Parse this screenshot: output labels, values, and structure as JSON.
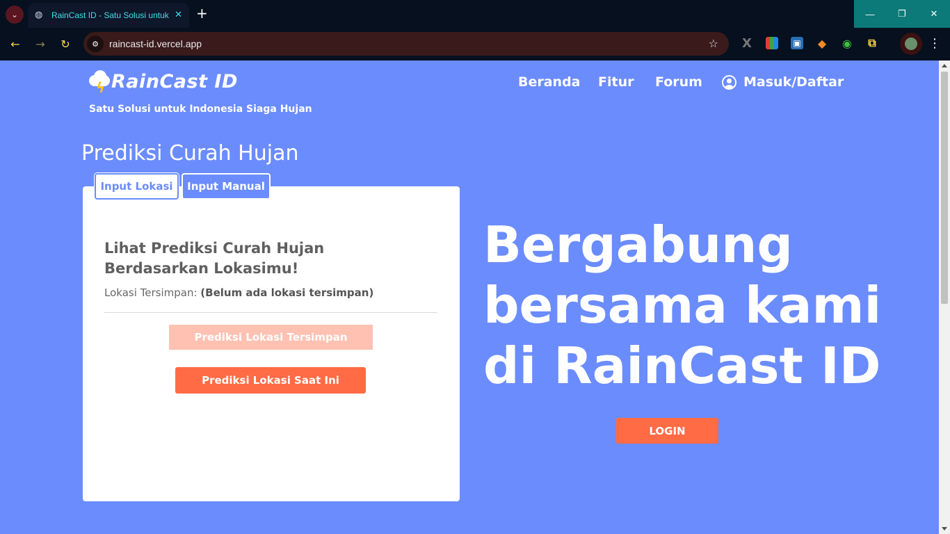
{
  "browser": {
    "tab_title": "RainCast ID - Satu Solusi untuk Indonesia Siaga Hujan",
    "url": "raincast-id.vercel.app",
    "win_minimize": "—",
    "win_restore": "❐",
    "win_close": "✕"
  },
  "header": {
    "brand": "RainCast ID",
    "tagline": "Satu Solusi untuk Indonesia Siaga Hujan",
    "nav": [
      "Beranda",
      "Fitur",
      "Forum"
    ],
    "login_label": "Masuk/Daftar"
  },
  "prediction": {
    "title": "Prediksi Curah Hujan",
    "tabs": [
      "Input Lokasi",
      "Input Manual"
    ],
    "active_tab": "Input Lokasi",
    "heading": "Lihat Prediksi Curah Hujan Berdasarkan Lokasimu!",
    "saved_label": "Lokasi Tersimpan:",
    "saved_value": "(Belum ada lokasi tersimpan)",
    "btn_saved": "Prediksi Lokasi Tersimpan",
    "btn_current": "Prediksi Lokasi Saat Ini"
  },
  "hero": {
    "line1": "Bergabung",
    "line2": "bersama kami",
    "line3": "di RainCast ID",
    "login_button": "LOGIN"
  },
  "colors": {
    "page_bg": "#6b8cfd",
    "accent": "#ff6b45",
    "accent_disabled": "#ffc1b2"
  }
}
